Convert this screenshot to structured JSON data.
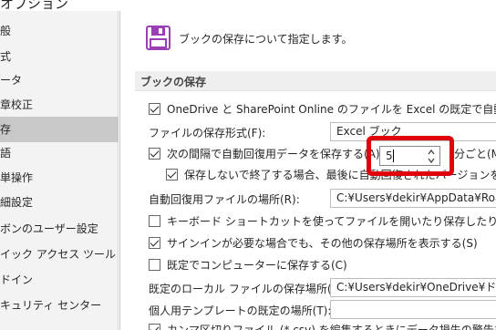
{
  "window": {
    "title": "オプション"
  },
  "sidebar": {
    "items": [
      {
        "label": "般",
        "selected": false
      },
      {
        "label": "式",
        "selected": false
      },
      {
        "label": "ータ",
        "selected": false
      },
      {
        "label": "章校正",
        "selected": false
      },
      {
        "label": "存",
        "selected": true
      },
      {
        "label": "語",
        "selected": false
      },
      {
        "label": "単操作",
        "selected": false
      },
      {
        "label": "細設定",
        "selected": false
      },
      {
        "label": "ボンのユーザー設定",
        "selected": false
      },
      {
        "label": "イック アクセス ツール バー",
        "selected": false
      },
      {
        "label": "ドイン",
        "selected": false
      },
      {
        "label": "キュリティ センター",
        "selected": false
      }
    ]
  },
  "main": {
    "page_title": "ブックの保存について指定します。",
    "page_icon": "save-icon",
    "section_title": "ブックの保存",
    "rows": {
      "onedrive_default": {
        "label": "OneDrive と SharePoint Online のファイルを Excel の既定で自動保存する",
        "checked": true
      },
      "file_format_label": "ファイルの保存形式(F):",
      "file_format_value": "Excel ブック",
      "autorecover_label": "次の間隔で自動回復用データを保存する(A)",
      "autorecover_checked": true,
      "autorecover_minutes": "5",
      "autorecover_unit": "分ごと(M)",
      "keep_last": {
        "label": "保存しないで終了する場合、最後に自動回復されたバージョンを残す(U)",
        "checked": true
      },
      "autorecover_location_label": "自動回復用ファイルの場所(R):",
      "autorecover_location_value": "C:¥Users¥dekir¥AppData¥Roaming¥Microsoft¥Excel¥",
      "keyboard_shortcut": {
        "label": "キーボード ショートカットを使ってファイルを開いたり保存したりするときに Backstage を表示しない",
        "checked": false
      },
      "show_additional": {
        "label": "サインインが必要な場合でも、その他の保存場所を表示する(S)",
        "checked": true
      },
      "save_to_computer": {
        "label": "既定でコンピューターに保存する(C)",
        "checked": false
      },
      "default_local_label": "既定のローカル ファイルの保存場所(I):",
      "default_local_value": "C:¥Users¥dekir¥OneDrive¥ドキュメント",
      "personal_templates_label": "個人用テンプレートの既定の場所(T):",
      "personal_templates_value": "",
      "csv_warning": {
        "label": "カンマ区切りファイル (*.csv) を編集するときにデータ損失の警告を表示する",
        "checked": true
      }
    }
  },
  "colors": {
    "highlight": "#e0000b",
    "sidebar_selected": "#c8c8c8",
    "sidebar_bg": "#f3f3f3"
  }
}
